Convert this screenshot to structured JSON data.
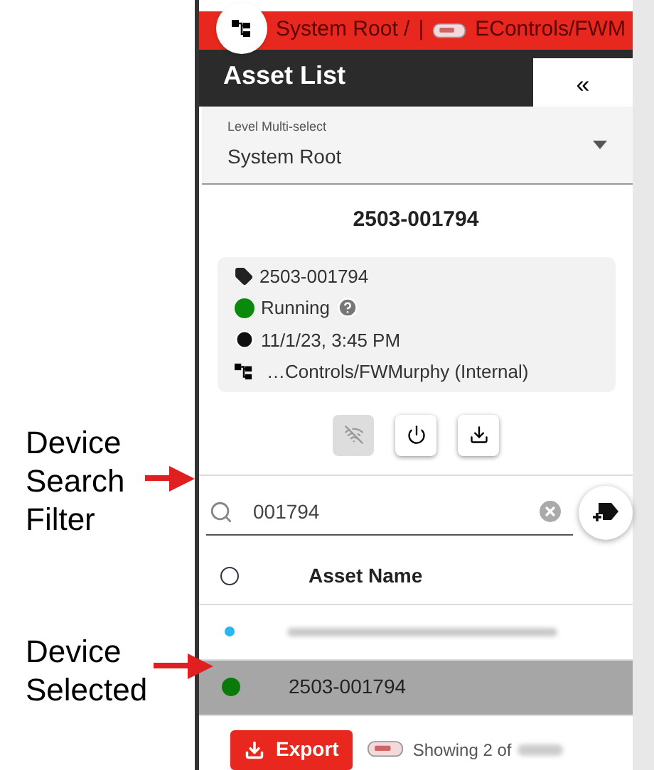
{
  "callouts": [
    {
      "lines": [
        "Device",
        "Search",
        "Filter"
      ]
    },
    {
      "lines": [
        "Device",
        "Selected"
      ]
    }
  ],
  "breadcrumb": {
    "root": "System Root /",
    "separator": "|",
    "path": "EControls/FWM"
  },
  "panel": {
    "title": "Asset List",
    "collapse": "«"
  },
  "level_select": {
    "label": "Level Multi-select",
    "value": "System Root"
  },
  "device": {
    "title": "2503-001794",
    "tag": "2503-001794",
    "status": {
      "text": "Running",
      "color": "#0a8a0a"
    },
    "time": "11/1/23, 3:45 PM",
    "path": "…Controls/FWMurphy (Internal)"
  },
  "actions": [
    {
      "kind": "signal",
      "disabled": true
    },
    {
      "kind": "power",
      "disabled": false
    },
    {
      "kind": "download",
      "disabled": false
    }
  ],
  "search": {
    "value": "001794"
  },
  "table": {
    "header": "Asset Name",
    "select_all": false,
    "rows": [
      {
        "kind": "redacted",
        "color": "#29b6f6",
        "selected": false
      },
      {
        "kind": "text",
        "name": "2503-001794",
        "color": "#0a7a0a",
        "selected": true
      }
    ]
  },
  "footer": {
    "export": "Export",
    "showing": "Showing 2 of"
  }
}
